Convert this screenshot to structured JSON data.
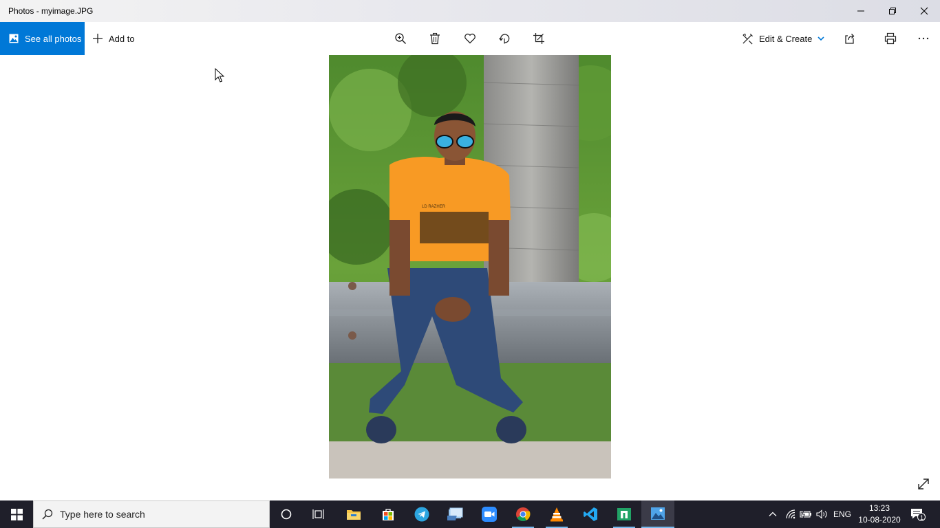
{
  "window": {
    "title": "Photos - myimage.JPG"
  },
  "cmdbar": {
    "see_all_label": "See all photos",
    "add_to_label": "Add to",
    "tools": [
      "zoom-icon",
      "delete-icon",
      "favorite-icon",
      "rotate-icon",
      "crop-icon"
    ],
    "edit_create_label": "Edit & Create",
    "right_tools": [
      "share-icon",
      "print-icon",
      "more-icon"
    ]
  },
  "taskbar": {
    "search_placeholder": "Type here to search",
    "pinned": [
      "cortana-icon",
      "task-view-icon",
      "file-explorer-icon",
      "store-icon",
      "telegram-icon",
      "user-folder-icon",
      "zoom-app-icon",
      "chrome-icon",
      "vlc-icon",
      "vscode-icon",
      "app-icon",
      "photos-icon"
    ],
    "language": "ENG",
    "time": "13:23",
    "date": "10-08-2020",
    "notification_count": "1"
  },
  "colors": {
    "accent": "#0078d7",
    "taskbar": "#1f1f2a",
    "shirt": "#f89a24"
  }
}
